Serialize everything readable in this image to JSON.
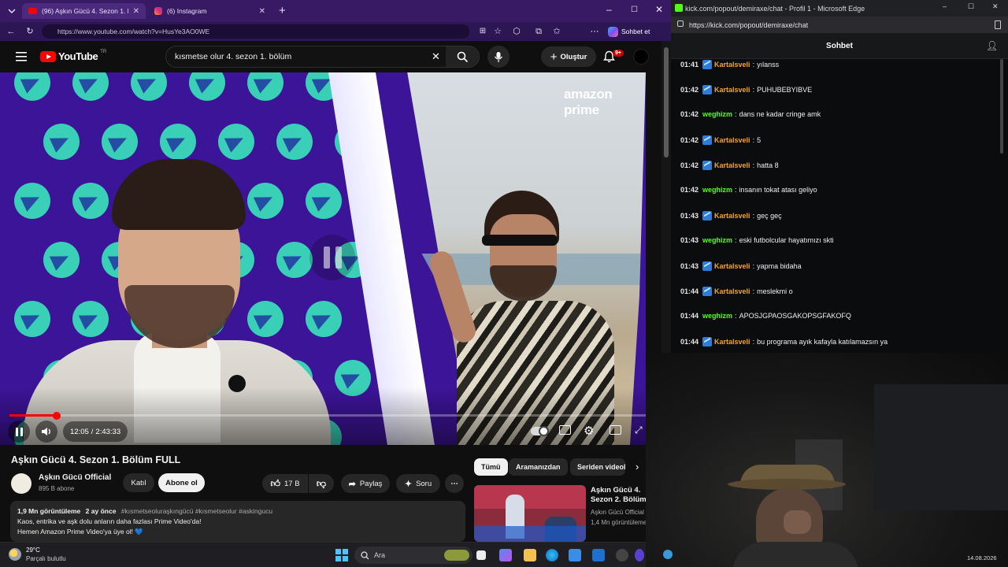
{
  "browser_left": {
    "tabs": [
      {
        "label": "(96) Aşkın Gücü 4. Sezon 1. Bölüm"
      },
      {
        "label": "(6) Instagram"
      }
    ],
    "new_tab": "+",
    "url": "https://www.youtube.com/watch?v=HusYe3AO0WE",
    "sohbet_label": "Sohbet et"
  },
  "youtube": {
    "logo_text": "YouTube",
    "region": "TR",
    "search_query": "kısmetse olur 4. sezon 1. bölüm",
    "create_label": "Oluştur",
    "notif_count": "9+",
    "video": {
      "watermark": "amazon prime",
      "current_time": "12:05",
      "duration": "2:43:33",
      "progress": 0.074
    },
    "title": "Aşkın Gücü 4. Sezon 1. Bölüm FULL",
    "channel_name": "Aşkın Gücü Official",
    "subscribers": "895 B abone",
    "join_label": "Katıl",
    "subscribe_label": "Abone ol",
    "likes": "17 B",
    "share_label": "Paylaş",
    "ask_label": "Soru",
    "views": "1,9 Mn görüntüleme",
    "posted": "2 ay önce",
    "hashtags": "#kısmetseoluraşkıngücü #kısmetseolur #askingucu",
    "desc_line1": "Kaos, entrika ve aşk dolu anların daha fazlası Prime Video'da!",
    "desc_line2": "Hemen Amazon Prime Video'ya üye ol! 💙",
    "chips": [
      "Tümü",
      "Aramanızdan",
      "Seriden videol"
    ],
    "rec_title_1": "Aşkın Gücü 4.",
    "rec_title_2": "Sezon 2. Bölüm",
    "rec_channel": "Aşkın Gücü Official",
    "rec_views": "1,4 Mn görüntüleme"
  },
  "kick": {
    "window_title": "kick.com/popout/demiraxe/chat - Profil 1 - Microsoft Edge",
    "url": "https://kick.com/popout/demiraxe/chat",
    "chat_title": "Sohbet",
    "messages": [
      {
        "time": "01:41",
        "user": "Kartalsveli",
        "color": "#f5a524",
        "badge": true,
        "text": "yılanss"
      },
      {
        "time": "01:42",
        "user": "Kartalsveli",
        "color": "#f5a524",
        "badge": true,
        "text": "PUHUBEBYIBVE"
      },
      {
        "time": "01:42",
        "user": "weghizm",
        "color": "#53fc18",
        "badge": false,
        "text": "dans ne kadar cringe amk"
      },
      {
        "time": "01:42",
        "user": "Kartalsveli",
        "color": "#f5a524",
        "badge": true,
        "text": "5"
      },
      {
        "time": "01:42",
        "user": "Kartalsveli",
        "color": "#f5a524",
        "badge": true,
        "text": "hatta 8"
      },
      {
        "time": "01:42",
        "user": "weghizm",
        "color": "#53fc18",
        "badge": false,
        "text": "insanın tokat atası geliyo"
      },
      {
        "time": "01:43",
        "user": "Kartalsveli",
        "color": "#f5a524",
        "badge": true,
        "text": "geç geç"
      },
      {
        "time": "01:43",
        "user": "weghizm",
        "color": "#53fc18",
        "badge": false,
        "text": "eski futbolcular hayatımızı skti"
      },
      {
        "time": "01:43",
        "user": "Kartalsveli",
        "color": "#f5a524",
        "badge": true,
        "text": "yapma bidaha"
      },
      {
        "time": "01:44",
        "user": "Kartalsveli",
        "color": "#f5a524",
        "badge": true,
        "text": "meslekmi o"
      },
      {
        "time": "01:44",
        "user": "weghizm",
        "color": "#53fc18",
        "badge": false,
        "text": "APOSJGPAOSGAKOPSGFAKOFQ"
      },
      {
        "time": "01:44",
        "user": "Kartalsveli",
        "color": "#f5a524",
        "badge": true,
        "text": "bu programa ayık kafayla katılamazsın ya"
      }
    ]
  },
  "taskbar": {
    "temperature": "29°C",
    "weather": "Parçalı bulutlu",
    "search_label": "Ara",
    "date": "14.08.2026"
  }
}
